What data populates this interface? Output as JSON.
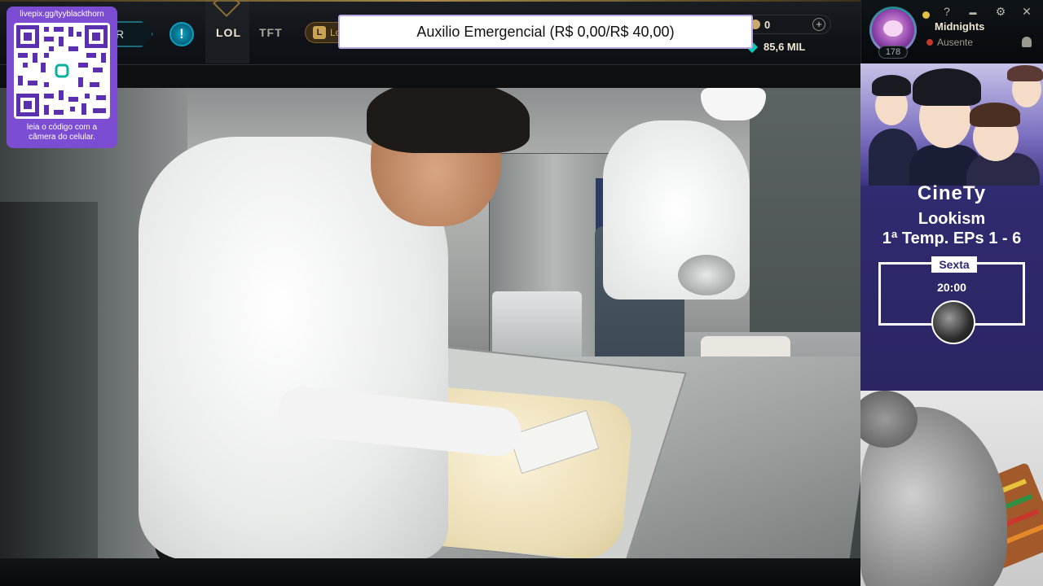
{
  "client": {
    "nav_tabs": [
      {
        "label": "LOL",
        "active": true
      },
      {
        "label": "TFT",
        "active": false
      }
    ],
    "play_button_text": "R",
    "loot_button_text": "Lo",
    "alert_glyph": "!",
    "currency": {
      "rp": "0",
      "blue_essence": "85,6 MIL",
      "add_glyph": "+"
    }
  },
  "donation_banner": {
    "text": "Auxilio Emergencial (R$ 0,00/R$ 40,00)"
  },
  "qr_overlay": {
    "url": "livepix.gg/tyyblackthorn",
    "caption_line1": "leia o código com a",
    "caption_line2": "câmera do celular."
  },
  "profile": {
    "summoner_name": "Midnights",
    "status": "Ausente",
    "level": "178",
    "icons": [
      "help-icon",
      "minimize-icon",
      "settings-icon",
      "close-icon",
      "notification-bell-icon"
    ],
    "help_glyph": "?",
    "minimize_glyph": "▬",
    "settings_glyph": "⚙",
    "close_glyph": "✕"
  },
  "promo": {
    "brand": "CineTy",
    "title": "Lookism",
    "subtitle": "1ª Temp. EPs 1 - 6",
    "day": "Sexta",
    "time": "20:00"
  },
  "colors": {
    "qr_card": "#7c4dd3",
    "promo_bg": "#2f2a6e",
    "client_gold": "#c8aa6e",
    "status_away": "#c0392b"
  }
}
